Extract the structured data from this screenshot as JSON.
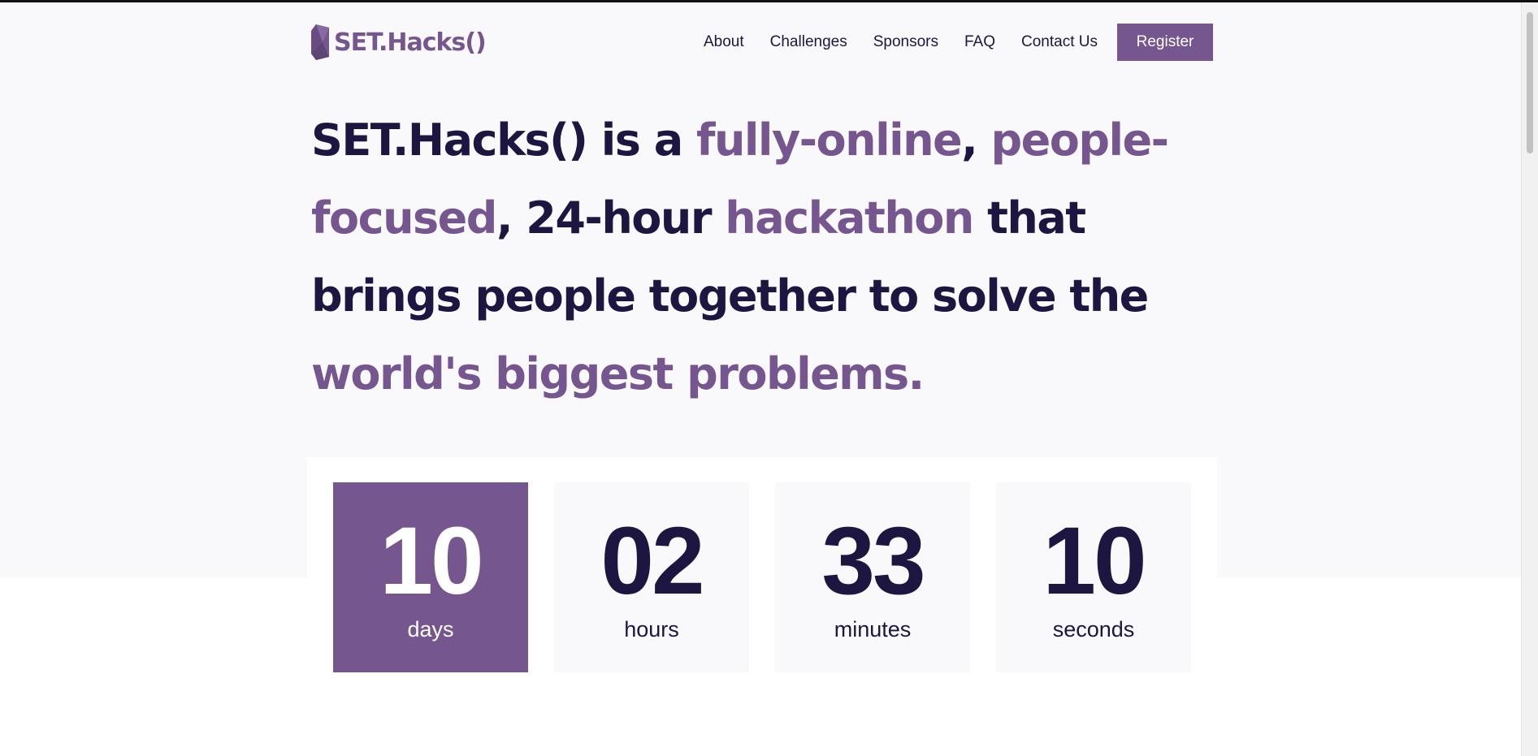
{
  "brand": {
    "name": "SET.Hacks()",
    "color": "#76568e",
    "logo_icon": "gem-icon"
  },
  "nav": {
    "items": [
      "About",
      "Challenges",
      "Sponsors",
      "FAQ",
      "Contact Us"
    ],
    "register_label": "Register"
  },
  "hero": {
    "segments": [
      {
        "text": "SET.Hacks() is a ",
        "highlight": false
      },
      {
        "text": "fully-online",
        "highlight": true
      },
      {
        "text": ", ",
        "highlight": false
      },
      {
        "text": "people-focused",
        "highlight": true
      },
      {
        "text": ", 24-hour ",
        "highlight": false
      },
      {
        "text": "hackathon",
        "highlight": true
      },
      {
        "text": " that brings people together to solve the ",
        "highlight": false
      },
      {
        "text": "world's biggest problems.",
        "highlight": true
      }
    ]
  },
  "countdown": [
    {
      "value": "10",
      "label": "days"
    },
    {
      "value": "02",
      "label": "hours"
    },
    {
      "value": "33",
      "label": "minutes"
    },
    {
      "value": "10",
      "label": "seconds"
    }
  ],
  "colors": {
    "accent": "#76568e",
    "text": "#1d1640",
    "hero_bg": "#f9f9fc"
  }
}
